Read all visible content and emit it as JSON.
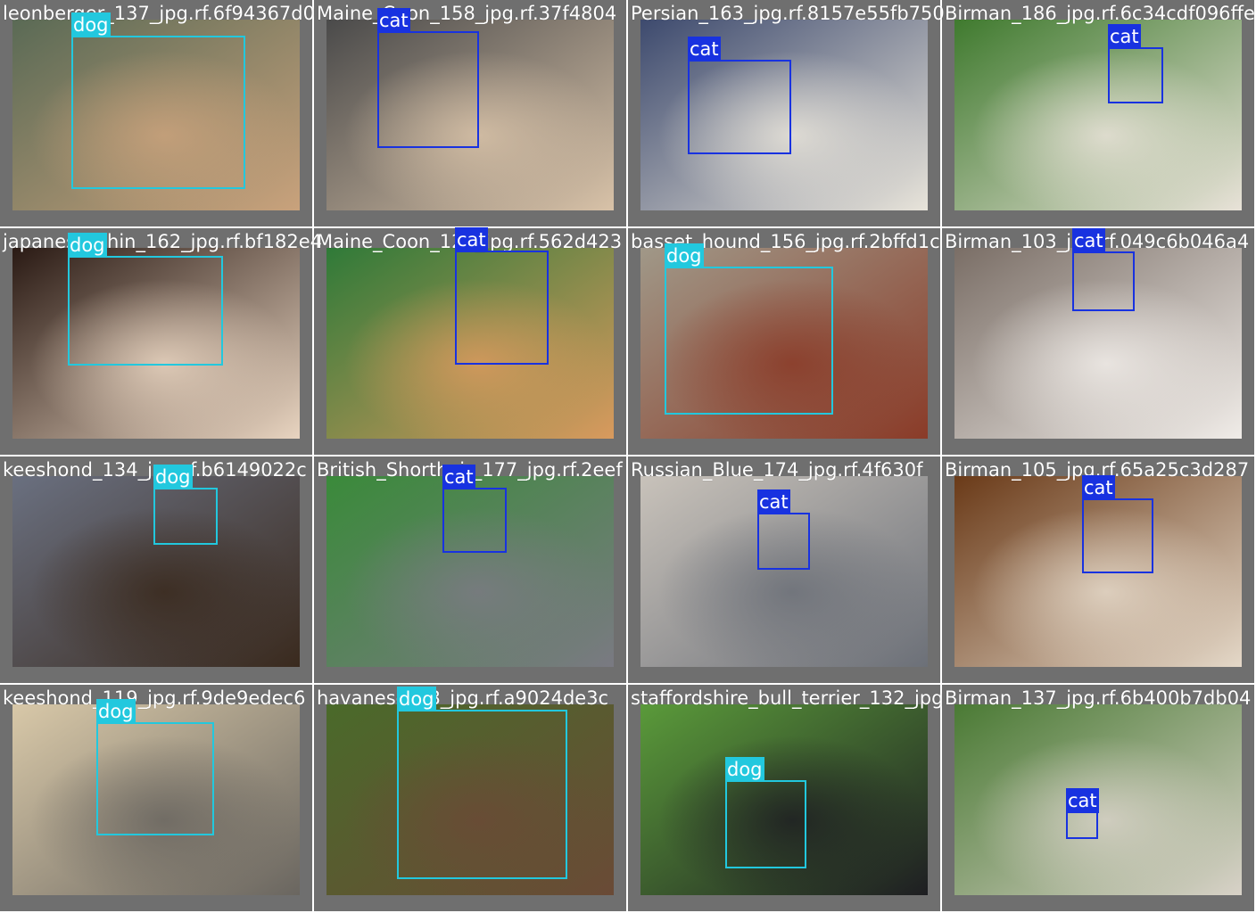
{
  "colors": {
    "dog": "#22c8de",
    "cat": "#1832e0",
    "frame": "#6f6f6f"
  },
  "tiles": [
    {
      "filename": "leonberger_137_jpg.rf.6f94367d0",
      "label": "dog",
      "cls": "dog",
      "bg": [
        "#5a6a55",
        "#c9a27c"
      ],
      "box": {
        "l": 80,
        "t": 40,
        "w": 195,
        "h": 172
      }
    },
    {
      "filename": "Maine_Coon_158_jpg.rf.37f4804",
      "label": "cat",
      "cls": "cat",
      "bg": [
        "#4a4a4a",
        "#d8c2a8"
      ],
      "box": {
        "l": 71,
        "t": 35,
        "w": 114,
        "h": 131
      }
    },
    {
      "filename": "Persian_163_jpg.rf.8157e55fb750",
      "label": "cat",
      "cls": "cat",
      "bg": [
        "#3d4a6e",
        "#e8e4da"
      ],
      "box": {
        "l": 67,
        "t": 67,
        "w": 116,
        "h": 106
      }
    },
    {
      "filename": "Birman_186_jpg.rf.6c34cdf096ffe",
      "label": "cat",
      "cls": "cat",
      "bg": [
        "#3f7a2e",
        "#e8e2d8"
      ],
      "box": {
        "l": 186,
        "t": 53,
        "w": 62,
        "h": 63
      }
    },
    {
      "filename": "japanese_chin_162_jpg.rf.bf182e4",
      "label": "dog",
      "cls": "dog",
      "bg": [
        "#2a1a14",
        "#e8d4c0"
      ],
      "box": {
        "l": 76,
        "t": 287,
        "w": 174,
        "h": 123
      }
    },
    {
      "filename": "Maine_Coon_123_jpg.rf.562d423",
      "label": "cat",
      "cls": "cat",
      "bg": [
        "#2f7a38",
        "#d99a5e"
      ],
      "box": {
        "l": 158,
        "t": 281,
        "w": 105,
        "h": 128
      }
    },
    {
      "filename": "basset_hound_156_jpg.rf.2bffd1c",
      "label": "dog",
      "cls": "dog",
      "bg": [
        "#a09888",
        "#8a3b28"
      ],
      "box": {
        "l": 41,
        "t": 299,
        "w": 189,
        "h": 166
      }
    },
    {
      "filename": "Birman_103_jpg.rf.049c6b046a4",
      "label": "cat",
      "cls": "cat",
      "bg": [
        "#7a6e66",
        "#f0ece8"
      ],
      "box": {
        "l": 146,
        "t": 282,
        "w": 70,
        "h": 67
      }
    },
    {
      "filename": "keeshond_134_jpg.rf.b6149022c",
      "label": "dog",
      "cls": "dog",
      "bg": [
        "#6a7080",
        "#3a2a1e"
      ],
      "box": {
        "l": 172,
        "t": 547,
        "w": 72,
        "h": 64
      }
    },
    {
      "filename": "British_Shorthair_177_jpg.rf.2eef",
      "label": "cat",
      "cls": "cat",
      "bg": [
        "#3a8a3a",
        "#7a7a82"
      ],
      "box": {
        "l": 144,
        "t": 547,
        "w": 72,
        "h": 73
      }
    },
    {
      "filename": "Russian_Blue_174_jpg.rf.4f630f",
      "label": "cat",
      "cls": "cat",
      "bg": [
        "#c8c2ba",
        "#6c7078"
      ],
      "box": {
        "l": 145,
        "t": 575,
        "w": 59,
        "h": 64
      }
    },
    {
      "filename": "Birman_105_jpg.rf.65a25c3d287",
      "label": "cat",
      "cls": "cat",
      "bg": [
        "#6a3a18",
        "#e4d8c8"
      ],
      "box": {
        "l": 157,
        "t": 559,
        "w": 80,
        "h": 84
      }
    },
    {
      "filename": "keeshond_119_jpg.rf.9de9edec6",
      "label": "dog",
      "cls": "dog",
      "bg": [
        "#d8c8a8",
        "#6a6660"
      ],
      "box": {
        "l": 108,
        "t": 810,
        "w": 132,
        "h": 127
      }
    },
    {
      "filename": "havanese_18_jpg.rf.a9024de3c",
      "label": "dog",
      "cls": "dog",
      "bg": [
        "#4a6a2a",
        "#6a4a36"
      ],
      "box": {
        "l": 93,
        "t": 796,
        "w": 191,
        "h": 190
      }
    },
    {
      "filename": "staffordshire_bull_terrier_132_jpg",
      "label": "dog",
      "cls": "dog",
      "bg": [
        "#5a9a3a",
        "#1e1e22"
      ],
      "box": {
        "l": 109,
        "t": 875,
        "w": 91,
        "h": 99
      }
    },
    {
      "filename": "Birman_137_jpg.rf.6b400b7db04",
      "label": "cat",
      "cls": "cat",
      "bg": [
        "#4a7a34",
        "#d8d2c8"
      ],
      "box": {
        "l": 139,
        "t": 910,
        "w": 36,
        "h": 31
      }
    }
  ]
}
